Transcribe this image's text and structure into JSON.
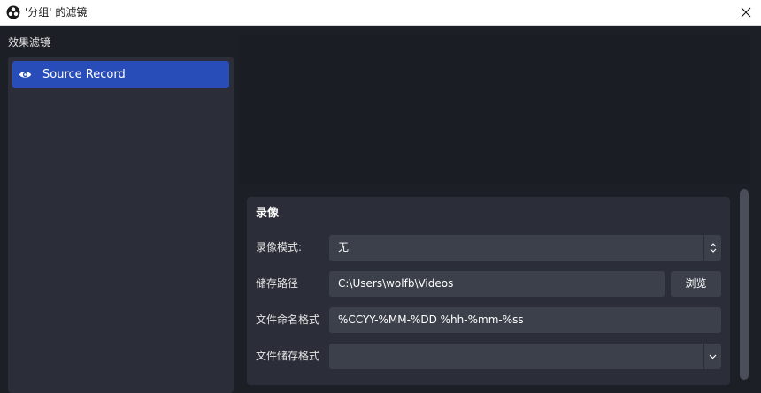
{
  "window": {
    "title": "'分组' 的滤镜",
    "app_icon": "obs-logo-icon",
    "close_icon": "close-icon"
  },
  "filters_panel": {
    "label": "效果滤镜",
    "items": [
      {
        "label": "Source Record",
        "icon": "eye-icon",
        "selected": true
      }
    ]
  },
  "properties": {
    "group_title": "录像",
    "rows": [
      {
        "label": "录像模式:",
        "value": "无",
        "control": "select",
        "arrow_icon": "updown-arrows-icon"
      },
      {
        "label": "储存路径",
        "value": "C:\\Users\\wolfb\\Videos",
        "control": "text"
      },
      {
        "label": "文件命名格式",
        "value": "%CCYY-%MM-%DD %hh-%mm-%ss",
        "control": "text"
      },
      {
        "label": "文件储存格式",
        "value": "",
        "control": "combo",
        "arrow_icon": "chevron-down-icon"
      }
    ],
    "browse_label": "浏览"
  },
  "colors": {
    "background": "#1d1f26",
    "panel": "#2b2e38",
    "input": "#3c404b",
    "accent": "#284cb8",
    "preview": "#1a1d24"
  }
}
